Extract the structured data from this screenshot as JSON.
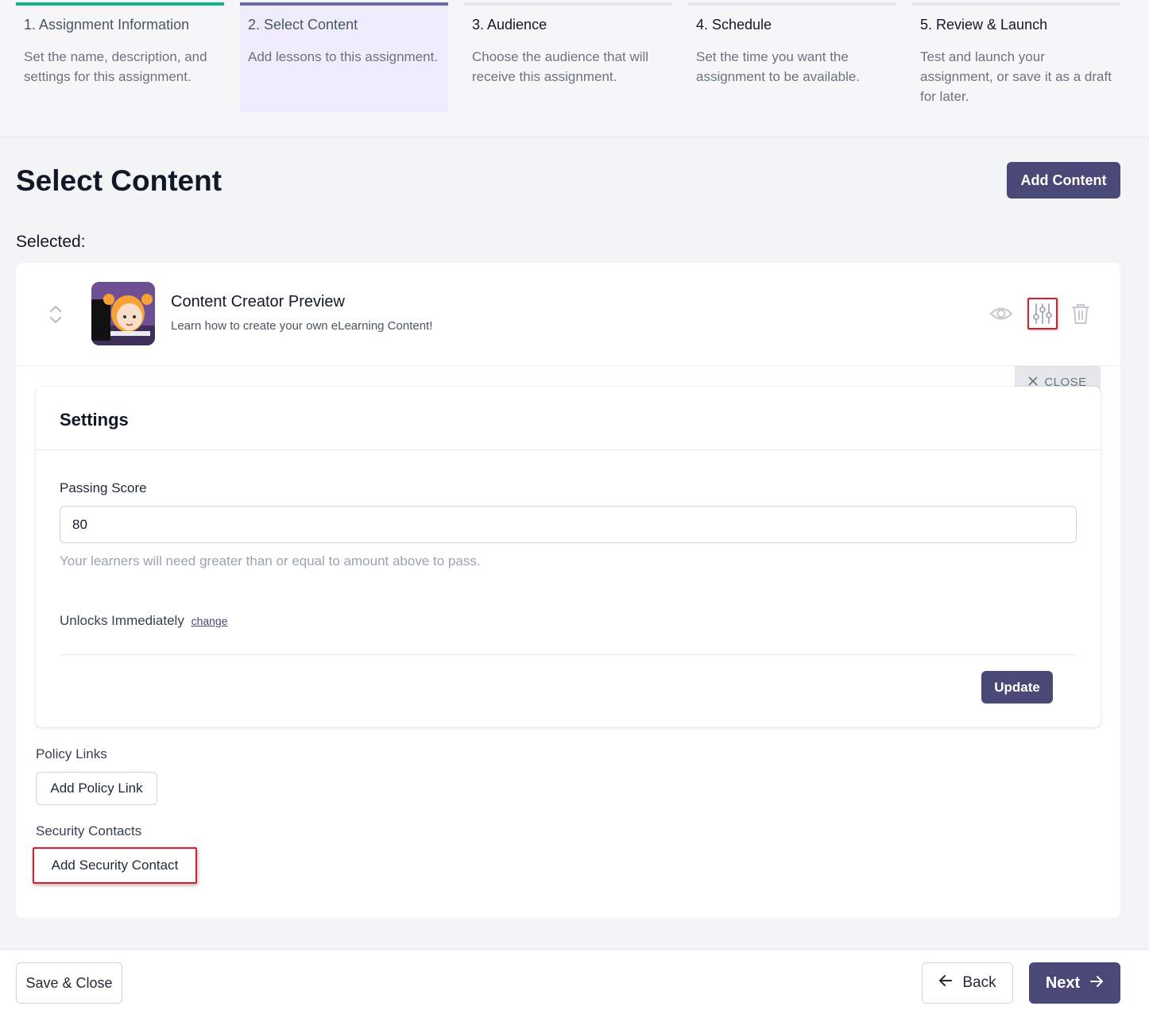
{
  "steps": [
    {
      "title": "1. Assignment Information",
      "desc": "Set the name, description, and settings for this assignment."
    },
    {
      "title": "2. Select Content",
      "desc": "Add lessons to this assignment."
    },
    {
      "title": "3. Audience",
      "desc": "Choose the audience that will receive this assignment."
    },
    {
      "title": "4. Schedule",
      "desc": "Set the time you want the assignment to be available."
    },
    {
      "title": "5. Review & Launch",
      "desc": "Test and launch your assignment, or save it as a draft for later."
    }
  ],
  "page": {
    "title": "Select Content",
    "add_content_label": "Add Content",
    "selected_label": "Selected:"
  },
  "content": {
    "title": "Content Creator Preview",
    "desc": "Learn how to create your own eLearning Content!",
    "icons": [
      "drag-handle-icon",
      "eye-icon",
      "sliders-icon",
      "trash-icon"
    ]
  },
  "settings": {
    "close_label": "CLOSE",
    "title": "Settings",
    "passing_label": "Passing Score",
    "passing_value": "80",
    "passing_help": "Your learners will need greater than or equal to amount above to pass.",
    "unlocks_label": "Unlocks Immediately",
    "change_link": "change",
    "update_label": "Update"
  },
  "policy": {
    "label": "Policy Links",
    "button": "Add Policy Link"
  },
  "security": {
    "label": "Security Contacts",
    "button": "Add Security Contact"
  },
  "footer": {
    "save_close": "Save & Close",
    "back": "Back",
    "next": "Next"
  },
  "colors": {
    "primary": "#4a4876",
    "step_done": "#10b981",
    "step_active_bg": "#eeecfd",
    "highlight": "#d9202a"
  }
}
